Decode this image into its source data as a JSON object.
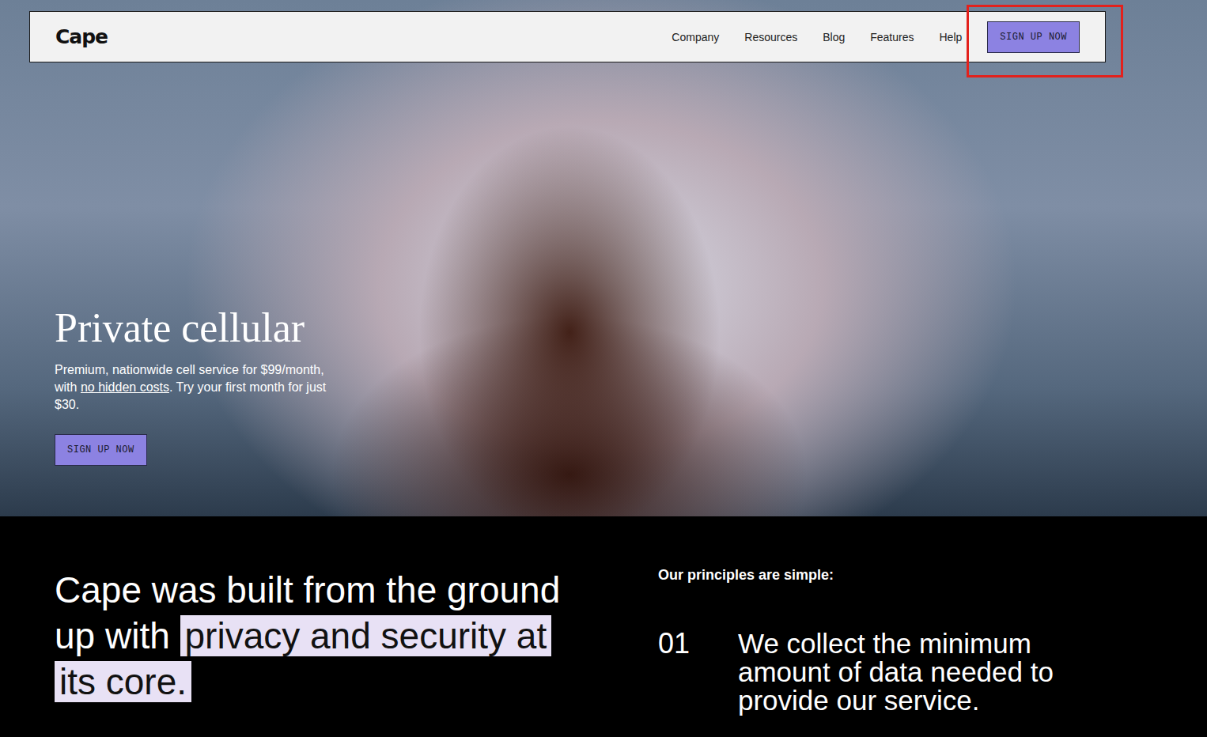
{
  "nav": {
    "logo": "Cape",
    "links": [
      "Company",
      "Resources",
      "Blog",
      "Features",
      "Help"
    ],
    "cta": {
      "label": "SIGN UP NOW",
      "highlighted": true
    }
  },
  "hero": {
    "title": "Private cellular",
    "body": [
      {
        "text": "Premium, nationwide cell service for $99/month, with ",
        "underline": false
      },
      {
        "text": "no hidden costs",
        "underline": true
      },
      {
        "text": ". Try your first month for just $30.",
        "underline": false
      }
    ],
    "cta": "SIGN UP NOW"
  },
  "about": {
    "headline": [
      {
        "text": "Cape was built from the ground up with ",
        "highlighted": false
      },
      {
        "text": "privacy and security at its core.",
        "highlighted": true
      }
    ],
    "principles_title": "Our principles are simple:",
    "principles": [
      {
        "number": "01",
        "text": "We collect the minimum amount of data needed to provide our service."
      }
    ]
  }
}
